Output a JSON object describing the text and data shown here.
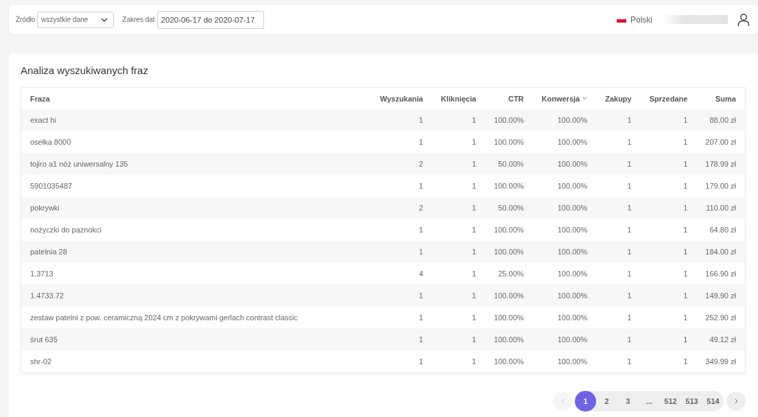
{
  "filters": {
    "source_label": "Źródło",
    "source_value": "wszystkie dane",
    "date_label": "Zakres dat",
    "date_value": "2020-06-17 do 2020-07-17"
  },
  "header": {
    "language": "Polski"
  },
  "panel": {
    "title": "Analiza wyszukiwanych fraz"
  },
  "table": {
    "columns": [
      {
        "label": "Fraza",
        "sorted": false
      },
      {
        "label": "Wyszukania",
        "sorted": false
      },
      {
        "label": "Kliknięcia",
        "sorted": false
      },
      {
        "label": "CTR",
        "sorted": false
      },
      {
        "label": "Konwersja",
        "sorted": true
      },
      {
        "label": "Zakupy",
        "sorted": false
      },
      {
        "label": "Sprzedane",
        "sorted": false
      },
      {
        "label": "Suma",
        "sorted": false
      }
    ],
    "rows": [
      [
        "exact hi",
        "1",
        "1",
        "100.00%",
        "100.00%",
        "1",
        "1",
        "88.00 zł"
      ],
      [
        "osełka 8000",
        "1",
        "1",
        "100.00%",
        "100.00%",
        "1",
        "1",
        "207.00 zł"
      ],
      [
        "tojiro a1 nóż uniwersalny 135",
        "2",
        "1",
        "50.00%",
        "100.00%",
        "1",
        "1",
        "178.99 zł"
      ],
      [
        "5901035487",
        "1",
        "1",
        "100.00%",
        "100.00%",
        "1",
        "1",
        "179.00 zł"
      ],
      [
        "pokrywki",
        "2",
        "1",
        "50.00%",
        "100.00%",
        "1",
        "1",
        "110.00 zł"
      ],
      [
        "nożyczki do paznokci",
        "1",
        "1",
        "100.00%",
        "100.00%",
        "1",
        "1",
        "64.80 zł"
      ],
      [
        "patelnia 28",
        "1",
        "1",
        "100.00%",
        "100.00%",
        "1",
        "1",
        "184.00 zł"
      ],
      [
        "1.3713",
        "4",
        "1",
        "25.00%",
        "100.00%",
        "1",
        "1",
        "166.90 zł"
      ],
      [
        "1.4733.72",
        "1",
        "1",
        "100.00%",
        "100.00%",
        "1",
        "1",
        "149.90 zł"
      ],
      [
        "zestaw patelni z pow. ceramiczną 2024 cm z pokrywami gerlach contrast classic",
        "1",
        "1",
        "100.00%",
        "100.00%",
        "1",
        "1",
        "252.90 zł"
      ],
      [
        "śrut 635",
        "1",
        "1",
        "100.00%",
        "100.00%",
        "1",
        "1",
        "49.12 zł"
      ],
      [
        "shr-02",
        "1",
        "1",
        "100.00%",
        "100.00%",
        "1",
        "1",
        "349.99 zł"
      ]
    ]
  },
  "pagination": {
    "prev_disabled": true,
    "next_disabled": false,
    "pages": [
      {
        "label": "1",
        "selected": true
      },
      {
        "label": "2",
        "selected": false
      },
      {
        "label": "3",
        "selected": false
      },
      {
        "label": "...",
        "selected": false
      },
      {
        "label": "512",
        "selected": false
      },
      {
        "label": "513",
        "selected": false
      },
      {
        "label": "514",
        "selected": false
      }
    ]
  }
}
